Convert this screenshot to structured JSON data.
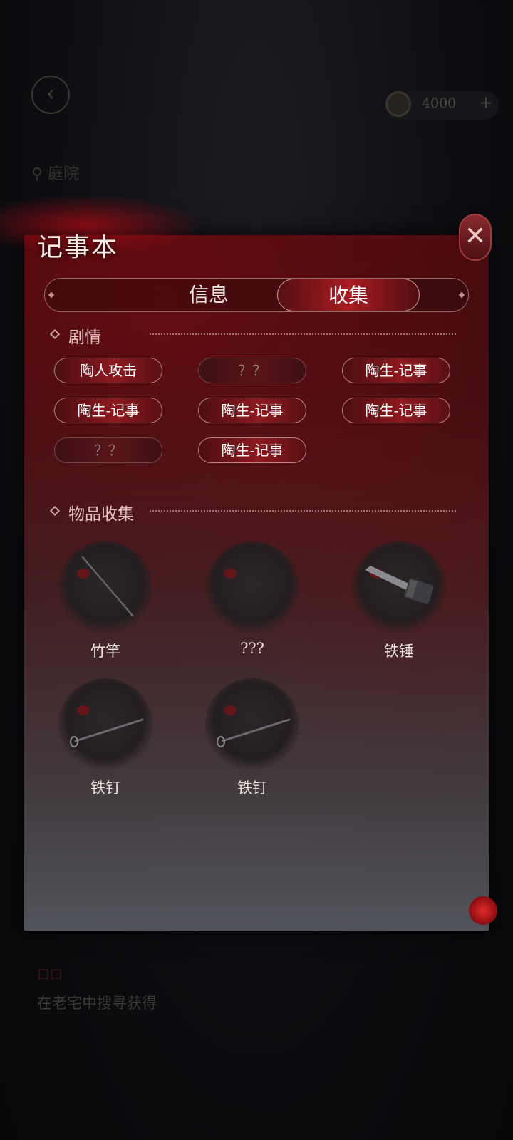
{
  "background": {
    "back_icon": "‹",
    "coin_amount": "4000",
    "plus_label": "+",
    "location": "庭院",
    "subtitle": "口口",
    "description": "在老宅中搜寻获得"
  },
  "notebook": {
    "title": "记事本",
    "close_label": "✕",
    "tabs": [
      {
        "label": "信息",
        "active": false
      },
      {
        "label": "收集",
        "active": true
      }
    ],
    "story_section": {
      "label": "剧情",
      "items": [
        {
          "label": "陶人攻击",
          "locked": false
        },
        {
          "label": "？？",
          "locked": true
        },
        {
          "label": "陶生-记事",
          "locked": false
        },
        {
          "label": "陶生-记事",
          "locked": false
        },
        {
          "label": "陶生-记事",
          "locked": false
        },
        {
          "label": "陶生-记事",
          "locked": false
        },
        {
          "label": "？？",
          "locked": true
        },
        {
          "label": "陶生-记事",
          "locked": false
        }
      ]
    },
    "items_section": {
      "label": "物品收集",
      "items": [
        {
          "name": "竹竿",
          "icon": "bamboo-pole-icon"
        },
        {
          "name": "???",
          "icon": "unknown-item-icon"
        },
        {
          "name": "铁锤",
          "icon": "iron-hammer-icon"
        },
        {
          "name": "铁钉",
          "icon": "iron-nail-icon"
        },
        {
          "name": "铁钉",
          "icon": "iron-nail-icon"
        }
      ]
    }
  },
  "colors": {
    "accent_red": "#8c1a20",
    "border": "#b98a84"
  }
}
